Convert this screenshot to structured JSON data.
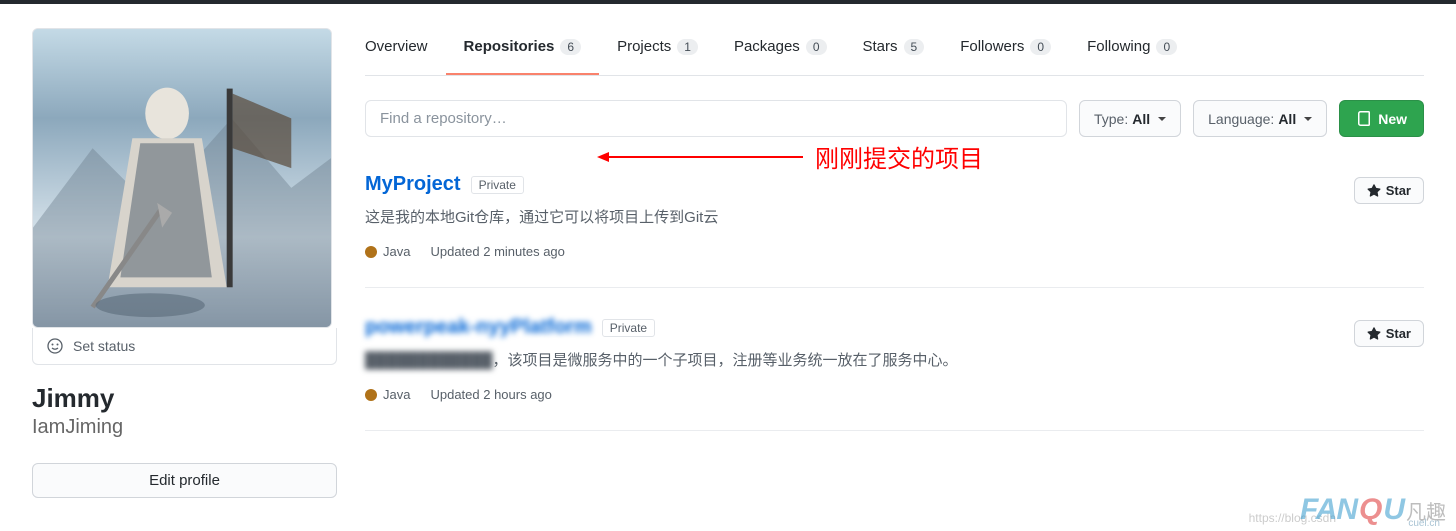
{
  "sidebar": {
    "status_text": "Set status",
    "name": "Jimmy",
    "username": "IamJiming",
    "edit_label": "Edit profile"
  },
  "tabs": [
    {
      "label": "Overview",
      "count": null
    },
    {
      "label": "Repositories",
      "count": "6"
    },
    {
      "label": "Projects",
      "count": "1"
    },
    {
      "label": "Packages",
      "count": "0"
    },
    {
      "label": "Stars",
      "count": "5"
    },
    {
      "label": "Followers",
      "count": "0"
    },
    {
      "label": "Following",
      "count": "0"
    }
  ],
  "filters": {
    "search_placeholder": "Find a repository…",
    "type_label": "Type:",
    "type_value": "All",
    "lang_label": "Language:",
    "lang_value": "All",
    "new_label": "New"
  },
  "annotation": "刚刚提交的项目",
  "repos": [
    {
      "name": "MyProject",
      "visibility": "Private",
      "desc_prefix": "",
      "desc": "这是我的本地Git仓库，通过它可以将项目上传到Git云",
      "lang": "Java",
      "updated": "Updated 2 minutes ago",
      "star_label": "Star"
    },
    {
      "name": "powerpeak-nyyPlatform",
      "visibility": "Private",
      "desc_prefix": "████████████",
      "desc": "，该项目是微服务中的一个子项目，注册等业务统一放在了服务中心。",
      "lang": "Java",
      "updated": "Updated 2 hours ago",
      "star_label": "Star"
    }
  ],
  "watermark": {
    "blog": "https://blog.csdn",
    "main1": "FAN",
    "main2": "Q",
    "main3": "U",
    "cn": "凡趣",
    "sub": "cuel.cn"
  }
}
